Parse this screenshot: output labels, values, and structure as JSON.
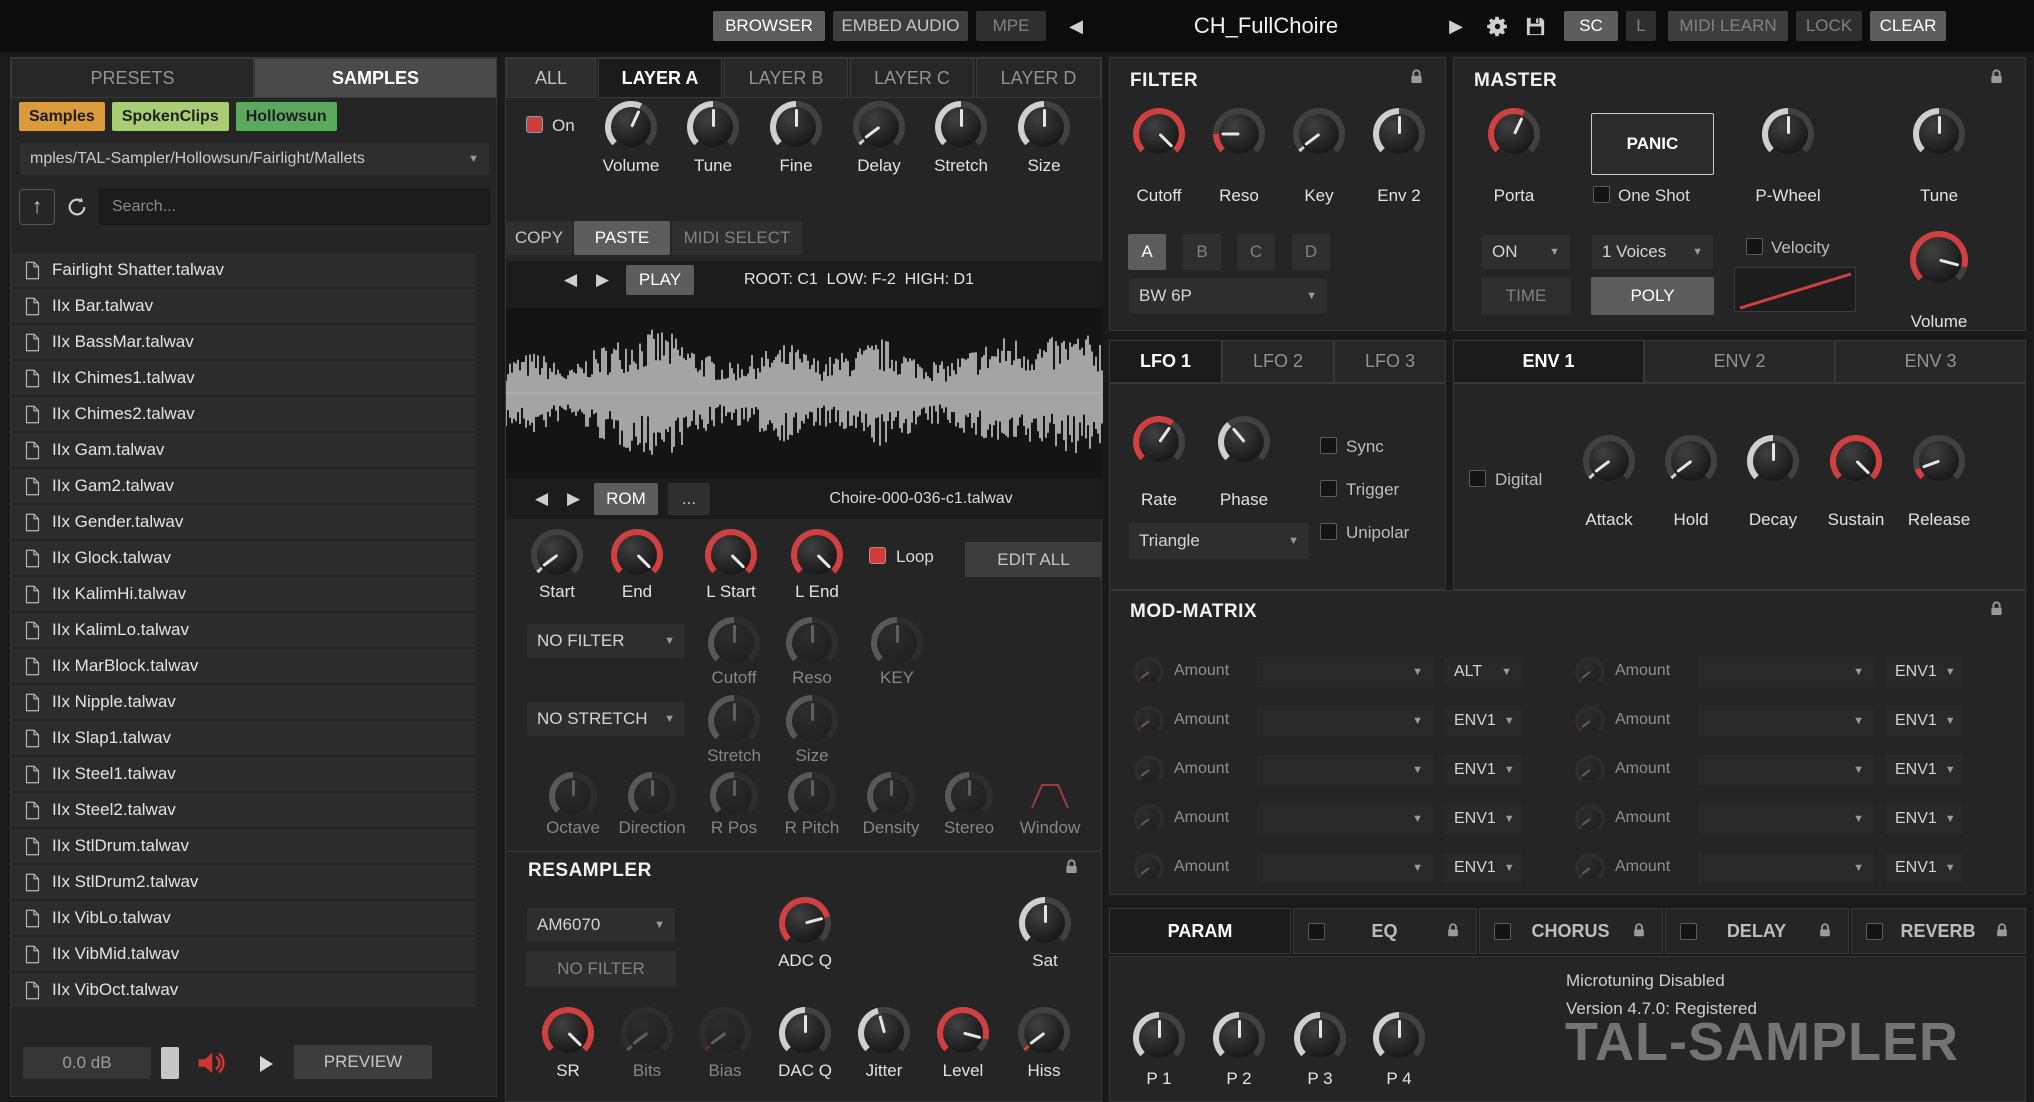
{
  "topbar": {
    "browser": "BROWSER",
    "embed_audio": "EMBED AUDIO",
    "mpe": "MPE",
    "title": "CH_FullChoire",
    "sc": "SC",
    "l": "L",
    "midi_learn": "MIDI LEARN",
    "lock": "LOCK",
    "clear": "CLEAR"
  },
  "sidebar": {
    "presets_tab": "PRESETS",
    "samples_tab": "SAMPLES",
    "tags": [
      {
        "label": "Samples",
        "color": "#d99b3c"
      },
      {
        "label": "SpokenClips",
        "color": "#a9cd74"
      },
      {
        "label": "Hollowsun",
        "color": "#5ba85f"
      }
    ],
    "path": "mples/TAL-Sampler/Hollowsun/Fairlight/Mallets",
    "search_placeholder": "Search...",
    "files": [
      "Fairlight Shatter.talwav",
      "IIx Bar.talwav",
      "IIx BassMar.talwav",
      "IIx Chimes1.talwav",
      "IIx Chimes2.talwav",
      "IIx Gam.talwav",
      "IIx Gam2.talwav",
      "IIx Gender.talwav",
      "IIx Glock.talwav",
      "IIx KalimHi.talwav",
      "IIx KalimLo.talwav",
      "IIx MarBlock.talwav",
      "IIx Nipple.talwav",
      "IIx Slap1.talwav",
      "IIx Steel1.talwav",
      "IIx Steel2.talwav",
      "IIx StlDrum.talwav",
      "IIx StlDrum2.talwav",
      "IIx VibLo.talwav",
      "IIx VibMid.talwav",
      "IIx VibOct.talwav"
    ],
    "level_db": "0.0 dB",
    "preview": "PREVIEW"
  },
  "layer": {
    "tabs": [
      "ALL",
      "LAYER A",
      "LAYER B",
      "LAYER C",
      "LAYER D"
    ],
    "on_label": "On",
    "knobs": {
      "volume": "Volume",
      "tune": "Tune",
      "fine": "Fine",
      "delay": "Delay",
      "stretch": "Stretch",
      "size": "Size"
    },
    "copy": "COPY",
    "paste": "PASTE",
    "midi_select": "MIDI SELECT",
    "play": "PLAY",
    "range_info": "ROOT: C1  LOW: F-2  HIGH: D1",
    "rom": "ROM",
    "more": "...",
    "sample_name": "Choire-000-036-c1.talwav",
    "start": "Start",
    "end": "End",
    "l_start": "L Start",
    "l_end": "L End",
    "loop": "Loop",
    "edit_all": "EDIT ALL",
    "filter_dd": "NO FILTER",
    "cutoff": "Cutoff",
    "reso": "Reso",
    "key": "KEY",
    "stretch_dd": "NO STRETCH",
    "stretch2": "Stretch",
    "size2": "Size",
    "octave": "Octave",
    "direction": "Direction",
    "r_pos": "R Pos",
    "r_pitch": "R Pitch",
    "density": "Density",
    "stereo": "Stereo",
    "window": "Window"
  },
  "resampler": {
    "title": "RESAMPLER",
    "model": "AM6070",
    "no_filter": "NO FILTER",
    "adc_q": "ADC Q",
    "sat": "Sat",
    "sr": "SR",
    "bits": "Bits",
    "bias": "Bias",
    "dac_q": "DAC Q",
    "jitter": "Jitter",
    "level": "Level",
    "hiss": "Hiss"
  },
  "filter": {
    "title": "FILTER",
    "cutoff": "Cutoff",
    "reso": "Reso",
    "key": "Key",
    "env2": "Env 2",
    "groups": [
      "A",
      "B",
      "C",
      "D"
    ],
    "type": "BW 6P"
  },
  "master": {
    "title": "MASTER",
    "porta": "Porta",
    "panic": "PANIC",
    "one_shot": "One Shot",
    "p_wheel": "P-Wheel",
    "tune": "Tune",
    "on": "ON",
    "time": "TIME",
    "voices": "1 Voices",
    "poly": "POLY",
    "velocity": "Velocity",
    "volume": "Volume"
  },
  "lfo": {
    "tabs": [
      "LFO 1",
      "LFO 2",
      "LFO 3"
    ],
    "rate": "Rate",
    "phase": "Phase",
    "sync": "Sync",
    "trigger": "Trigger",
    "unipolar": "Unipolar",
    "wave": "Triangle"
  },
  "env": {
    "tabs": [
      "ENV 1",
      "ENV 2",
      "ENV 3"
    ],
    "digital": "Digital",
    "attack": "Attack",
    "hold": "Hold",
    "decay": "Decay",
    "sustain": "Sustain",
    "release": "Release"
  },
  "modmatrix": {
    "title": "MOD-MATRIX",
    "amount": "Amount",
    "left_sources": [
      "ALT",
      "ENV1",
      "ENV1",
      "ENV1",
      "ENV1"
    ],
    "right_sources": [
      "ENV1",
      "ENV1",
      "ENV1",
      "ENV1",
      "ENV1"
    ]
  },
  "fx": {
    "param": "PARAM",
    "eq": "EQ",
    "chorus": "CHORUS",
    "delay": "DELAY",
    "reverb": "REVERB"
  },
  "bottom": {
    "p1": "P 1",
    "p2": "P 2",
    "p3": "P 3",
    "p4": "P 4",
    "microtuning": "Microtuning Disabled",
    "version": "Version 4.7.0: Registered",
    "logo": "TAL-SAMPLER"
  },
  "colors": {
    "accent_red": "#d04040",
    "tag_orange": "#d99b3c",
    "tag_light_green": "#a9cd74",
    "tag_green": "#5ba85f"
  }
}
